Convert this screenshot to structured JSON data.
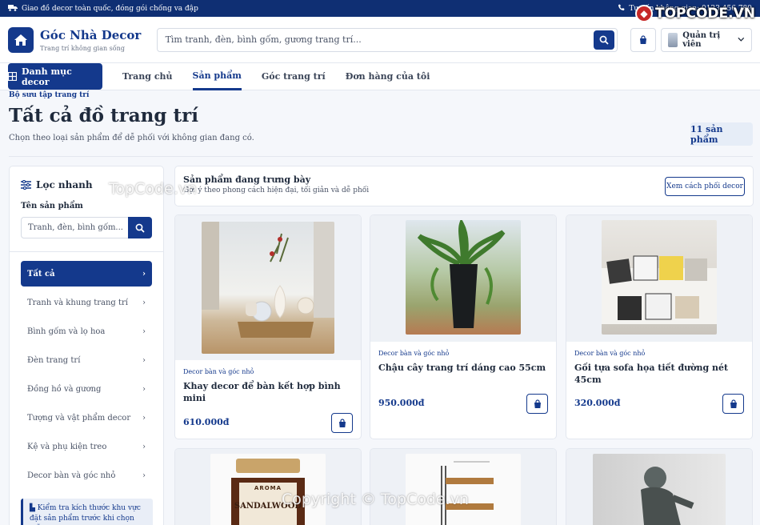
{
  "topbar": {
    "left_text": "Giao đồ decor toàn quốc, đóng gói chống va đập",
    "right_text": "Tư vấn không gian: 0123 456 789"
  },
  "watermark": {
    "logo_text": "TOPCODE.VN",
    "center_text": "TopCode.vn",
    "bottom_text": "Copyright © TopCode.vn"
  },
  "brand": {
    "name": "Góc Nhà Decor",
    "tagline": "Trang trí không gian sống"
  },
  "search": {
    "placeholder": "Tìm tranh, đèn, bình gốm, gương trang trí..."
  },
  "user": {
    "label": "Quản trị viên"
  },
  "nav": {
    "category_button": "Danh mục decor",
    "links": [
      {
        "label": "Trang chủ"
      },
      {
        "label": "Sản phẩm"
      },
      {
        "label": "Góc trang trí"
      },
      {
        "label": "Đơn hàng của tôi"
      }
    ]
  },
  "page": {
    "breadcrumb": "Bộ sưu tập trang trí",
    "title": "Tất cả đồ trang trí",
    "subtitle": "Chọn theo loại sản phẩm để dễ phối với không gian đang có.",
    "count": "11 sản phẩm"
  },
  "filter": {
    "title": "Lọc nhanh",
    "name_label": "Tên sản phẩm",
    "name_placeholder": "Tranh, đèn, bình gốm...",
    "categories": [
      {
        "label": "Tất cả"
      },
      {
        "label": "Tranh và khung trang trí"
      },
      {
        "label": "Bình gốm và lọ hoa"
      },
      {
        "label": "Đèn trang trí"
      },
      {
        "label": "Đồng hồ và gương"
      },
      {
        "label": "Tượng và vật phẩm decor"
      },
      {
        "label": "Kệ và phụ kiện treo"
      },
      {
        "label": "Decor bàn và góc nhỏ"
      }
    ],
    "tip": "Kiểm tra kích thước khu vực đặt sản phẩm trước khi chọn mẫu."
  },
  "showcase": {
    "title": "Sản phẩm đang trưng bày",
    "subtitle": "Gợi ý theo phong cách hiện đại, tối giản và dễ phối",
    "button": "Xem cách phối decor"
  },
  "products": [
    {
      "category": "Decor bàn và góc nhỏ",
      "name": "Khay decor để bàn kết hợp bình mini",
      "price": "610.000đ"
    },
    {
      "category": "Decor bàn và góc nhỏ",
      "name": "Chậu cây trang trí dáng cao 55cm",
      "price": "950.000đ"
    },
    {
      "category": "Decor bàn và góc nhỏ",
      "name": "Gối tựa sofa họa tiết đường nét 45cm",
      "price": "320.000đ"
    },
    {
      "category": "",
      "name": "",
      "price": "",
      "image_text": [
        "AROMA",
        "SANDALWOOD"
      ]
    },
    {
      "category": "",
      "name": "",
      "price": ""
    },
    {
      "category": "",
      "name": "",
      "price": ""
    }
  ]
}
